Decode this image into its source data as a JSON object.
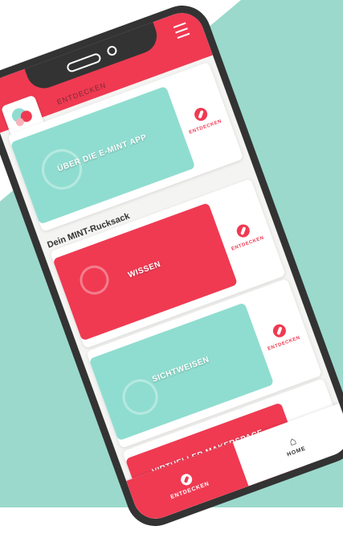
{
  "colors": {
    "accent": "#ef3a52",
    "teal": "#8fddd0",
    "frame": "#333333"
  },
  "header": {
    "peek_title": "ENTDECKEN",
    "logo": "e-mint-logo-icon",
    "menu": "hamburger-menu-icon"
  },
  "cards": [
    {
      "label": "ÜBER DIE E-MINT APP",
      "action": "ENTDECKEN",
      "color": "teal",
      "icon": "gear-icon"
    },
    {
      "label": "WISSEN",
      "action": "ENTDECKEN",
      "color": "red",
      "icon": "magnifier-icon"
    },
    {
      "label": "SICHTWEISEN",
      "action": "ENTDECKEN",
      "color": "teal",
      "icon": "thinking-face-icon"
    },
    {
      "label": "VIRTUELLER MAKERSPACE -",
      "action": "",
      "color": "red",
      "icon": ""
    }
  ],
  "section_title": "Dein MINT-Rucksack",
  "nav": {
    "left_label": "ENTDECKEN",
    "right_label": "HOME"
  }
}
